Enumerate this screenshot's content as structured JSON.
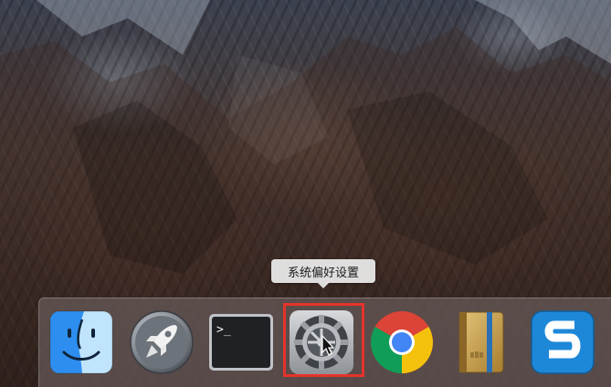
{
  "tooltip": {
    "text": "系统偏好设置"
  },
  "dock": {
    "items": [
      {
        "name": "finder",
        "icon": "finder-icon"
      },
      {
        "name": "launchpad",
        "icon": "rocket-icon"
      },
      {
        "name": "terminal",
        "icon": "terminal-icon",
        "prompt": ">_"
      },
      {
        "name": "system-preferences",
        "icon": "gear-icon",
        "active": true
      },
      {
        "name": "chrome",
        "icon": "chrome-icon"
      },
      {
        "name": "notebook",
        "icon": "notebook-icon"
      },
      {
        "name": "snagit",
        "icon": "snagit-icon",
        "glyph": "S"
      }
    ]
  },
  "colors": {
    "highlight": "#e6332a",
    "finder_left": "#2d8ef0",
    "finder_right": "#bfe4fb",
    "chrome_red": "#db4437",
    "chrome_yellow": "#f4c20d",
    "chrome_green": "#0f9d58",
    "chrome_blue": "#4285f4",
    "snagit_blue": "#1e88d8",
    "notebook_tan": "#c8a24f"
  }
}
